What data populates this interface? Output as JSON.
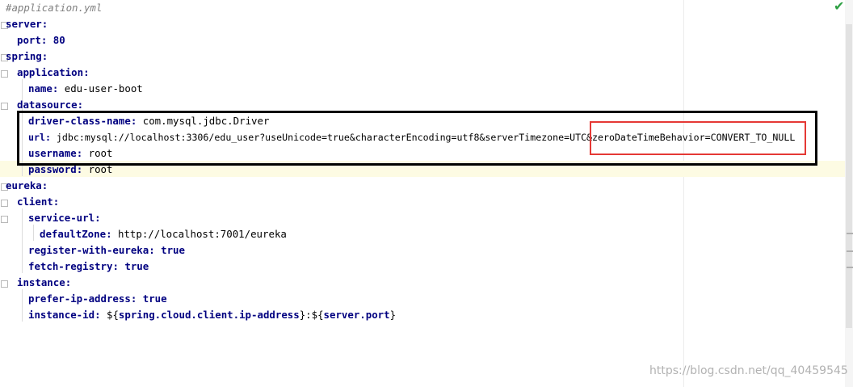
{
  "lines": [
    {
      "text": "#application.yml"
    },
    {
      "key": "server",
      "sep": ":"
    },
    {
      "key": "port",
      "sep": ": ",
      "value": "80"
    },
    {
      "key": "spring",
      "sep": ":"
    },
    {
      "key": "application",
      "sep": ":"
    },
    {
      "key": "name",
      "sep": ": ",
      "value": "edu-user-boot"
    },
    {
      "key": "datasource",
      "sep": ":"
    },
    {
      "key": "driver-class-name",
      "sep": ": ",
      "value": "com.mysql.jdbc.Driver"
    },
    {
      "key": "url",
      "sep": ": ",
      "value": "jdbc:mysql://localhost:3306/edu_user?useUnicode=true&characterEncoding=utf8&serverTimezone=UTC&zeroDateTimeBehavior=CONVERT_TO_NULL"
    },
    {
      "key": "username",
      "sep": ": ",
      "value": "root"
    },
    {
      "key": "password",
      "sep": ": ",
      "value": "root"
    },
    {
      "key": "eureka",
      "sep": ":"
    },
    {
      "key": "client",
      "sep": ":"
    },
    {
      "key": "service-url",
      "sep": ":"
    },
    {
      "key": "defaultZone",
      "sep": ": ",
      "value": "http://localhost:7001/eureka"
    },
    {
      "key": "register-with-eureka",
      "sep": ": ",
      "value": "true"
    },
    {
      "key": "fetch-registry",
      "sep": ": ",
      "value": "true"
    },
    {
      "key": "instance",
      "sep": ":"
    },
    {
      "key": "prefer-ip-address",
      "sep": ": ",
      "value": "true"
    },
    {
      "key": "instance-id",
      "sep": ": ",
      "v1": "${",
      "v2": "spring.cloud.client.ip-address",
      "v3": "}:${",
      "v4": "server.port",
      "v5": "}"
    }
  ],
  "watermark": "https://blog.csdn.net/qq_40459545",
  "status_icon": "check-icon",
  "colors": {
    "key": "#000080",
    "comment": "#808080",
    "highlight_box": "#e53935",
    "outline_box": "#000000"
  }
}
